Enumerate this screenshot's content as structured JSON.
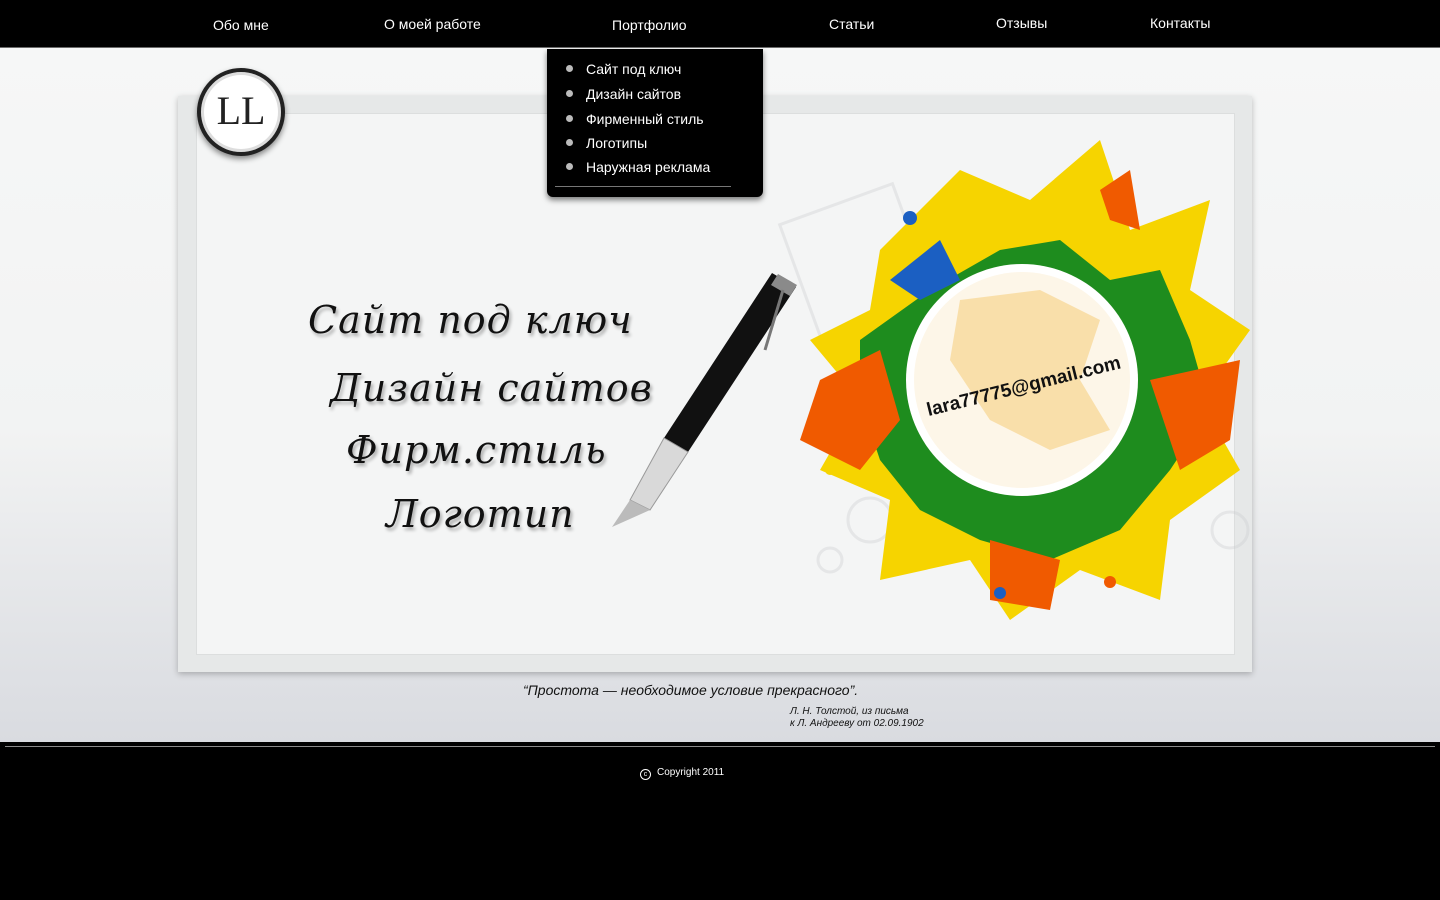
{
  "nav": {
    "items": [
      {
        "label": "Обо мне"
      },
      {
        "label": "О моей работе"
      },
      {
        "label": "Портфолио"
      },
      {
        "label": "Статьи"
      },
      {
        "label": "Отзывы"
      },
      {
        "label": "Контакты"
      }
    ]
  },
  "dropdown": {
    "items": [
      {
        "label": "Сайт под ключ"
      },
      {
        "label": "Дизайн сайтов"
      },
      {
        "label": "Фирменный стиль"
      },
      {
        "label": "Логотипы"
      },
      {
        "label": "Наружная реклама"
      }
    ]
  },
  "logo": {
    "text": "LL"
  },
  "hero": {
    "lines": [
      "Сайт под ключ",
      "Дизайн сайтов",
      "Фирм.стиль",
      "Логотип"
    ],
    "email": "lara77775@gmail.com"
  },
  "quote": {
    "text": "“Простота — необходимое условие прекрасного”.",
    "author_line1": "Л. Н. Толстой, из письма",
    "author_line2": "к Л. Андрееву от 02.09.1902"
  },
  "footer": {
    "copyright": "Copyright 2011",
    "copyright_icon": "copyright-icon"
  },
  "colors": {
    "background": "#000000",
    "accent_yellow": "#f6d400",
    "accent_orange": "#f05a00",
    "accent_green": "#1e8c1e",
    "accent_blue": "#1b5fc2"
  }
}
